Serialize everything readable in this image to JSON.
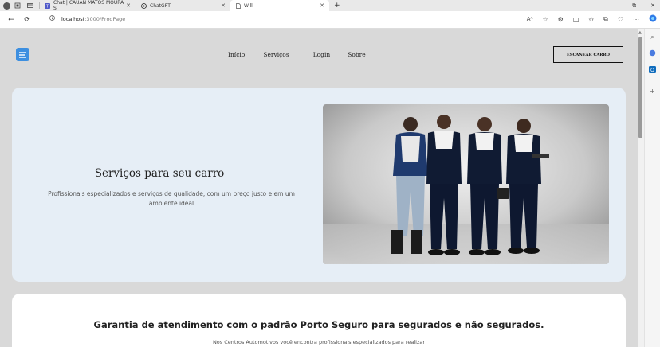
{
  "browser": {
    "tabs": [
      {
        "label": "Chat | CAUAN MATOS MOURA S",
        "icon": "teams-icon"
      },
      {
        "label": "ChatGPT",
        "icon": "chatgpt-icon"
      },
      {
        "label": "Will",
        "icon": "page-icon",
        "active": true
      }
    ],
    "new_tab": "+",
    "url_host": "localhost",
    "url_rest": ":3000/ProdPage",
    "reader_label": "Aᴬ",
    "window_min": "—",
    "window_max": "⧉",
    "window_close": "✕"
  },
  "header": {
    "nav": [
      "Início",
      "Serviços",
      "Login",
      "Sobre"
    ],
    "scan_button": "ESCANEAR CARRO"
  },
  "hero": {
    "title": "Serviços para seu carro",
    "subtitle": "Profissionais especializados e serviços de qualidade, com um preço justo e em um ambiente ideal"
  },
  "section2": {
    "title": "Garantia de atendimento com o padrão Porto Seguro para segurados e não segurados.",
    "subtitle": "Nos Centros Automotivos você encontra profissionais especializados para realizar"
  },
  "colors": {
    "accent": "#3d8fe0",
    "hero_bg": "#e6eef6",
    "page_bg": "#d9d9d9"
  }
}
